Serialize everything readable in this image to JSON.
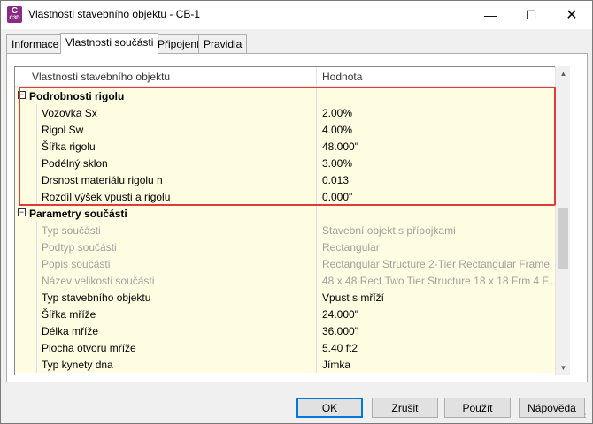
{
  "window": {
    "title": "Vlastnosti stavebního objektu - CB-1",
    "icon_label": "C",
    "icon_sublabel": "C3D"
  },
  "tabs": [
    {
      "label": "Informace",
      "active": false
    },
    {
      "label": "Vlastnosti součásti",
      "active": true
    },
    {
      "label": "Připojení",
      "active": false
    },
    {
      "label": "Pravidla",
      "active": false
    }
  ],
  "grid": {
    "col_property": "Vlastnosti stavebního objektu",
    "col_value": "Hodnota",
    "groups": [
      {
        "name": "Podrobnosti rigolu",
        "expander": "−",
        "rows": [
          {
            "label": "Vozovka Sx",
            "value": "2.00%"
          },
          {
            "label": "Rigol Sw",
            "value": "4.00%"
          },
          {
            "label": "Šířka rigolu",
            "value": "48.000\""
          },
          {
            "label": "Podélný sklon",
            "value": "3.00%"
          },
          {
            "label": "Drsnost materiálu rigolu n",
            "value": "0.013"
          },
          {
            "label": "Rozdíl výšek vpusti a rigolu",
            "value": "0.000\""
          }
        ]
      },
      {
        "name": "Parametry součásti",
        "expander": "−",
        "rows": [
          {
            "label": "Typ součásti",
            "value": "Stavební objekt s přípojkami"
          },
          {
            "label": "Podtyp součásti",
            "value": "Rectangular"
          },
          {
            "label": "Popis součásti",
            "value": "Rectangular Structure 2-Tier Rectangular Frame"
          },
          {
            "label": "Název velikosti součásti",
            "value": "48 x 48 Rect Two Tier Structure 18 x 18 Frm 4 F..."
          },
          {
            "label": "Typ stavebního objektu",
            "value": "Vpust s mříží"
          },
          {
            "label": "Šířka mříže",
            "value": "24.000\""
          },
          {
            "label": "Délka mříže",
            "value": "36.000\""
          },
          {
            "label": "Plocha otvoru mříže",
            "value": "5.40 ft2"
          },
          {
            "label": "Typ kynety dna",
            "value": "Jímka"
          }
        ]
      }
    ]
  },
  "buttons": {
    "ok": "OK",
    "cancel": "Zrušit",
    "apply": "Použít",
    "help": "Nápověda"
  },
  "colors": {
    "accent": "#0078d7",
    "highlight_box": "#e03a3a",
    "row_fill": "#fffde1"
  },
  "icons": {
    "minimize": "minimize-icon",
    "maximize": "maximize-icon",
    "close": "close-icon"
  }
}
